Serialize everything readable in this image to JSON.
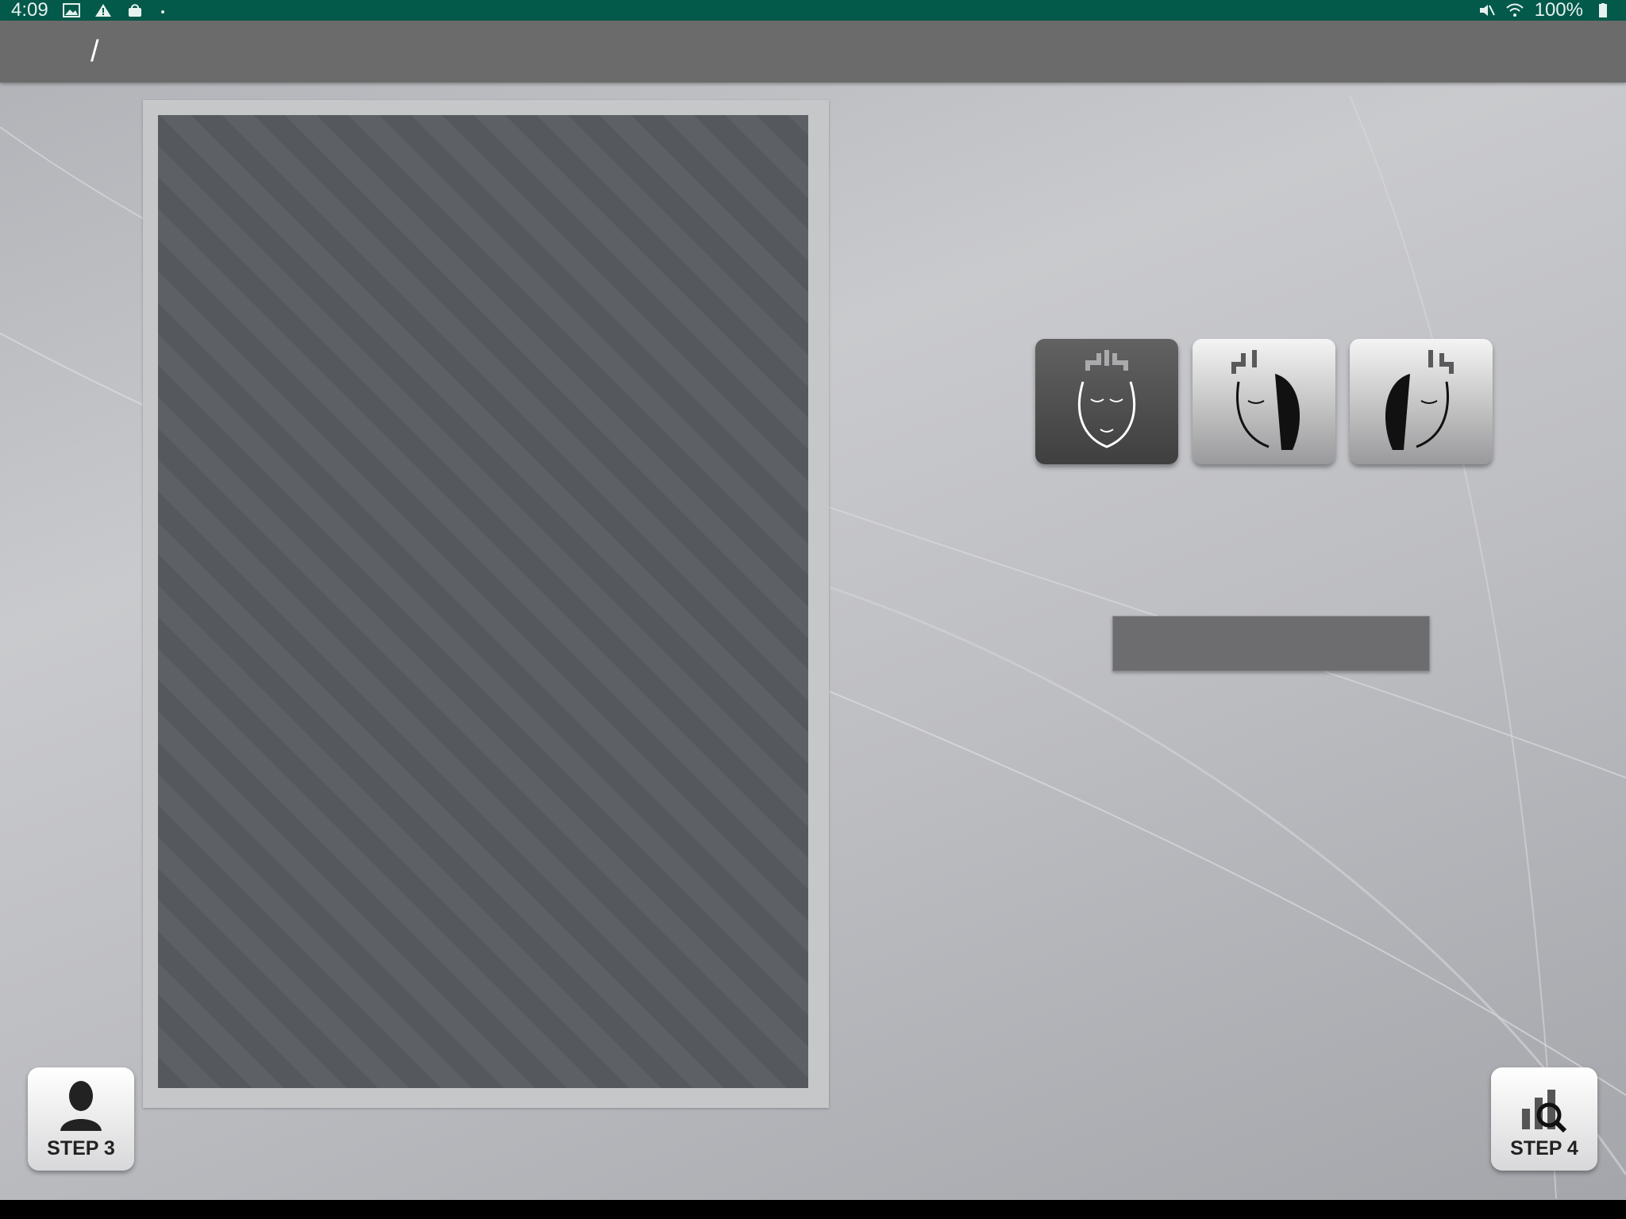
{
  "status_bar": {
    "time": "4:09",
    "battery": "100%",
    "left_icons": [
      "image-icon",
      "warning-icon",
      "bag-icon",
      "dot-icon"
    ],
    "right_icons": [
      "mute-icon",
      "wifi-icon",
      "battery-icon"
    ]
  },
  "header": {
    "patient_name": "",
    "separator": "/",
    "patient_age": ""
  },
  "main": {
    "photo": {
      "alt": ""
    },
    "view_buttons": [
      {
        "label": "",
        "icon": "face-front-icon",
        "selected": true
      },
      {
        "label": "",
        "icon": "face-right-icon",
        "selected": false
      },
      {
        "label": "",
        "icon": "face-left-icon",
        "selected": false
      }
    ],
    "capture_time": ""
  },
  "footer": {
    "step3_label": "STEP 3",
    "step3_icon": "person-icon",
    "step4_label": "STEP 4",
    "step4_icon": "analysis-chart-icon"
  },
  "colors": {
    "status_bar": "#03594a",
    "title_bar": "#6b6b6c",
    "selected_view": "#4f4f50"
  }
}
